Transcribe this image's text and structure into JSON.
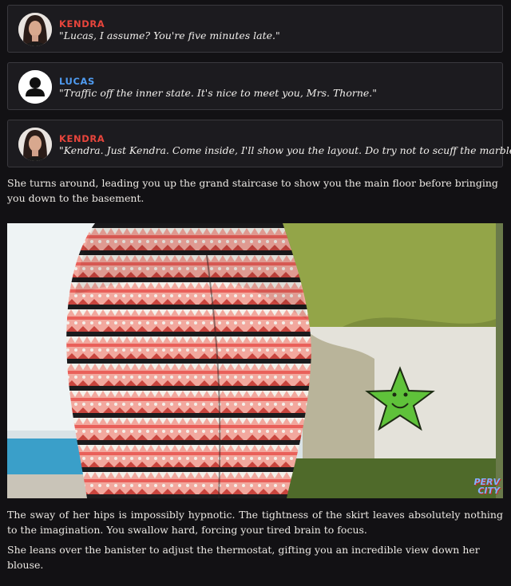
{
  "dialogue": [
    {
      "speaker": "KENDRA",
      "color": "#e8453c",
      "line": "\"Lucas, I assume? You're five minutes late.\"",
      "avatar": "woman-portrait"
    },
    {
      "speaker": "LUCAS",
      "color": "#4f9bf0",
      "line": "\"Traffic off the inner state. It's nice to meet you, Mrs. Thorne.\"",
      "avatar": "person-silhouette-icon"
    },
    {
      "speaker": "KENDRA",
      "color": "#e8453c",
      "line": "\"Kendra. Just Kendra. Come inside, I'll show you the layout. Do try not to scuff the marble.\"",
      "avatar": "woman-portrait"
    }
  ],
  "narration_1": "She turns around, leading you up the grand staircase to show you the main floor before bringing you down to the basement.",
  "image": {
    "watermark_line1": "PERV",
    "watermark_line2": "CITY"
  },
  "narration_2": "The sway of her hips is impossibly hypnotic. The tightness of the skirt leaves absolutely nothing to the imagination. You swallow hard, forcing your tired brain to focus.",
  "narration_3": "She leans over the banister to adjust the thermostat, gifting you an incredible view down her blouse."
}
